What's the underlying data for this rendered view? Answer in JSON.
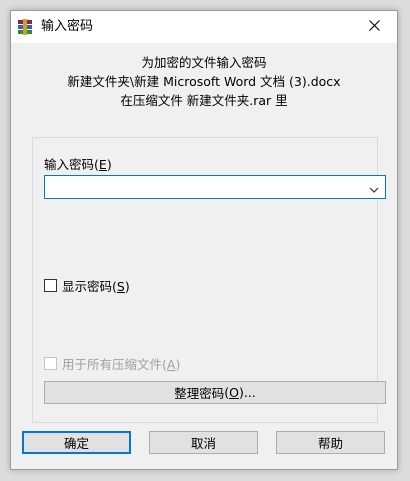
{
  "window": {
    "title": "输入密码",
    "close_icon": "close-icon",
    "app_icon": "winrar-icon"
  },
  "info": {
    "line1": "为加密的文件输入密码",
    "line2": "新建文件夹\\新建 Microsoft Word 文档 (3).docx",
    "line3": "在压缩文件 新建文件夹.rar 里"
  },
  "password": {
    "label": "输入密码",
    "label_accel": "E",
    "value": ""
  },
  "show_password": {
    "label": "显示密码",
    "accel": "S",
    "checked": false
  },
  "use_for_all": {
    "label": "用于所有压缩文件",
    "accel": "A",
    "checked": false,
    "enabled": false
  },
  "organize_button": {
    "label": "整理密码",
    "accel": "O",
    "suffix": "..."
  },
  "buttons": {
    "ok": "确定",
    "cancel": "取消",
    "help": "帮助"
  },
  "colors": {
    "accent": "#0078d7",
    "dialog_bg": "#f0f0f0",
    "button_bg": "#e1e1e1"
  }
}
